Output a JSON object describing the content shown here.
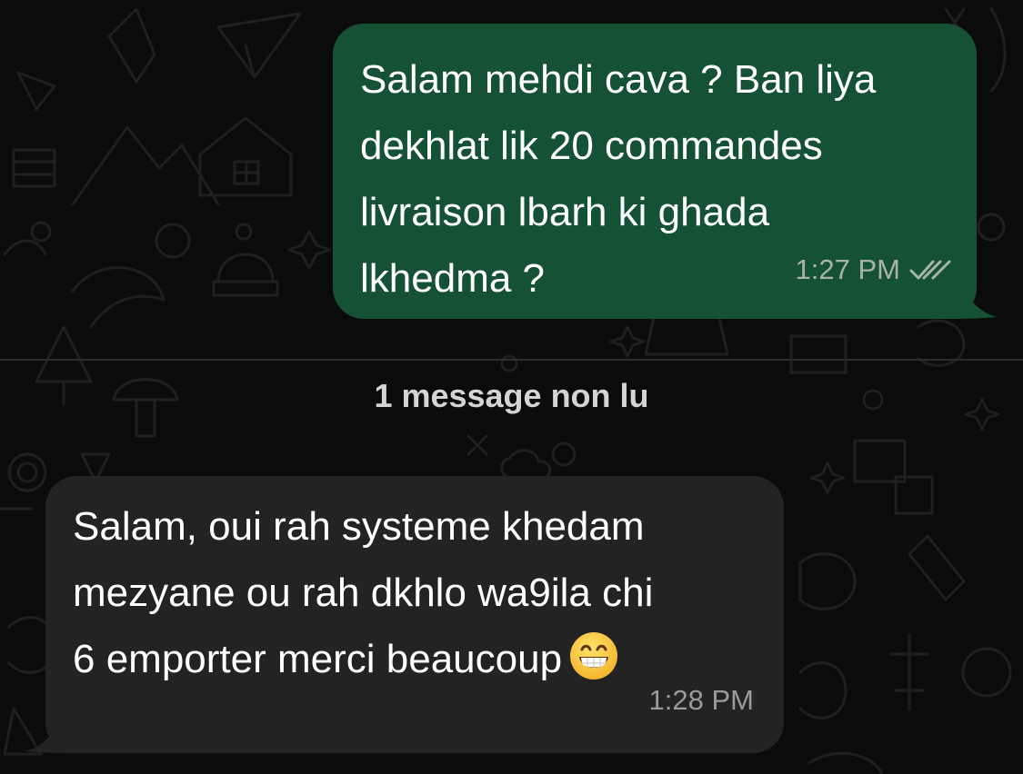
{
  "conversation": {
    "outgoing_message": {
      "lines": [
        "Salam mehdi cava ? Ban liya",
        "dekhlat lik 20 commandes",
        "livraison lbarh ki ghada",
        "lkhedma ?"
      ],
      "time": "1:27 PM",
      "status_icon": "double-check-read-icon"
    },
    "unread_divider": {
      "label": "1 message non lu"
    },
    "incoming_message": {
      "lines": [
        "Salam, oui rah systeme khedam",
        "mezyane ou rah dkhlo wa9ila chi",
        "6 emporter merci beaucoup"
      ],
      "emoji": "grinning-face-with-smiling-eyes-emoji",
      "time": "1:28 PM"
    }
  },
  "colors": {
    "background": "#0b0b0b",
    "outgoing_bubble": "#155134",
    "incoming_bubble": "#232323",
    "divider": "#2c2c2c"
  }
}
